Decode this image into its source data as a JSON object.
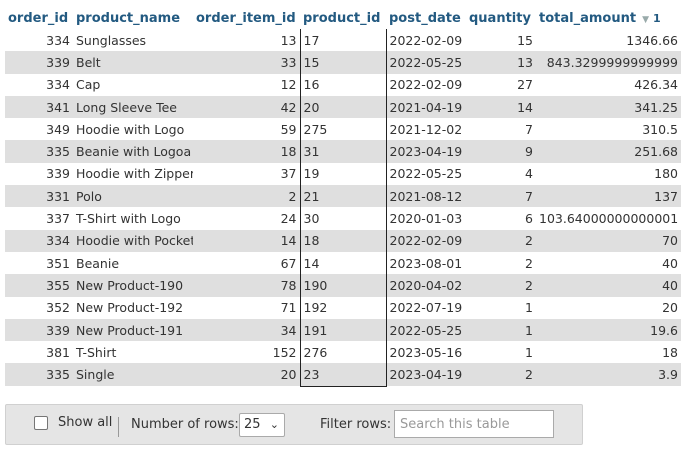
{
  "columns": [
    {
      "label": "order_id"
    },
    {
      "label": "product_name"
    },
    {
      "label": "order_item_id"
    },
    {
      "label": "product_id"
    },
    {
      "label": "post_date"
    },
    {
      "label": "quantity"
    },
    {
      "label": "total_amount",
      "sort_icon": "▼",
      "sort_order": "1"
    }
  ],
  "rows": [
    [
      "334",
      "Sunglasses",
      "13",
      "17",
      "2022-02-09",
      "15",
      "1346.66"
    ],
    [
      "339",
      "Belt",
      "33",
      "15",
      "2022-05-25",
      "13",
      "843.3299999999999"
    ],
    [
      "334",
      "Cap",
      "12",
      "16",
      "2022-02-09",
      "27",
      "426.34"
    ],
    [
      "341",
      "Long Sleeve Tee",
      "42",
      "20",
      "2021-04-19",
      "14",
      "341.25"
    ],
    [
      "349",
      "Hoodie with Logo",
      "59",
      "275",
      "2021-12-02",
      "7",
      "310.5"
    ],
    [
      "335",
      "Beanie with Logoa",
      "18",
      "31",
      "2023-04-19",
      "9",
      "251.68"
    ],
    [
      "339",
      "Hoodie with Zipper",
      "37",
      "19",
      "2022-05-25",
      "4",
      "180"
    ],
    [
      "331",
      "Polo",
      "2",
      "21",
      "2021-08-12",
      "7",
      "137"
    ],
    [
      "337",
      "T-Shirt with Logo",
      "24",
      "30",
      "2020-01-03",
      "6",
      "103.64000000000001"
    ],
    [
      "334",
      "Hoodie with Pocket",
      "14",
      "18",
      "2022-02-09",
      "2",
      "70"
    ],
    [
      "351",
      "Beanie",
      "67",
      "14",
      "2023-08-01",
      "2",
      "40"
    ],
    [
      "355",
      "New Product-190",
      "78",
      "190",
      "2020-04-02",
      "2",
      "40"
    ],
    [
      "352",
      "New Product-192",
      "71",
      "192",
      "2022-07-19",
      "1",
      "20"
    ],
    [
      "339",
      "New Product-191",
      "34",
      "191",
      "2022-05-25",
      "1",
      "19.6"
    ],
    [
      "381",
      "T-Shirt",
      "152",
      "276",
      "2023-05-16",
      "1",
      "18"
    ],
    [
      "335",
      "Single",
      "20",
      "23",
      "2023-04-19",
      "2",
      "3.9"
    ]
  ],
  "footer": {
    "show_all_label": "Show all",
    "rows_label": "Number of rows:",
    "rows_value": "25",
    "filter_label": "Filter rows:",
    "filter_placeholder": "Search this table"
  }
}
